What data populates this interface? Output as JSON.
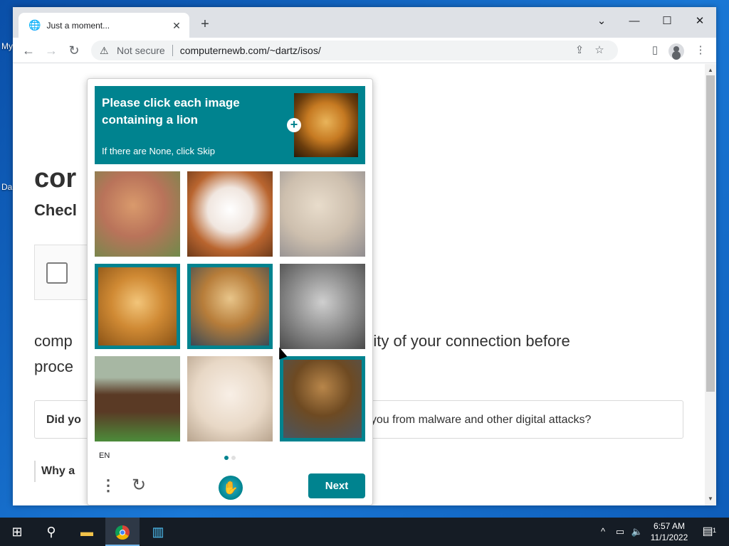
{
  "desktop": {
    "labels": [
      "My",
      "Da"
    ]
  },
  "browser": {
    "tab_title": "Just a moment...",
    "address": {
      "security": "Not secure",
      "url": "computernewb.com/~dartz/isos/"
    }
  },
  "page": {
    "title": "cor",
    "subtitle": "Checl",
    "paragraph_left": "comp",
    "paragraph_right": "curity of your connection before",
    "paragraph_line2": "proce",
    "did_prefix": "Did yo",
    "did_rest": "ct you from malware and other digital attacks?",
    "why_prefix": "Why a"
  },
  "captcha": {
    "prompt": "Please click each image containing a lion",
    "skip_hint": "If there are None, click Skip",
    "language": "EN",
    "next_label": "Next",
    "images": [
      {
        "subject": "dog",
        "selected": false
      },
      {
        "subject": "dog",
        "selected": false
      },
      {
        "subject": "lioness",
        "selected": false
      },
      {
        "subject": "lion",
        "selected": true
      },
      {
        "subject": "lion",
        "selected": true
      },
      {
        "subject": "cat",
        "selected": false
      },
      {
        "subject": "horse",
        "selected": false
      },
      {
        "subject": "dog",
        "selected": false
      },
      {
        "subject": "lion",
        "selected": true
      }
    ],
    "accent_color": "#00838f"
  },
  "taskbar": {
    "time": "6:57 AM",
    "date": "11/1/2022",
    "notification_count": "1"
  }
}
